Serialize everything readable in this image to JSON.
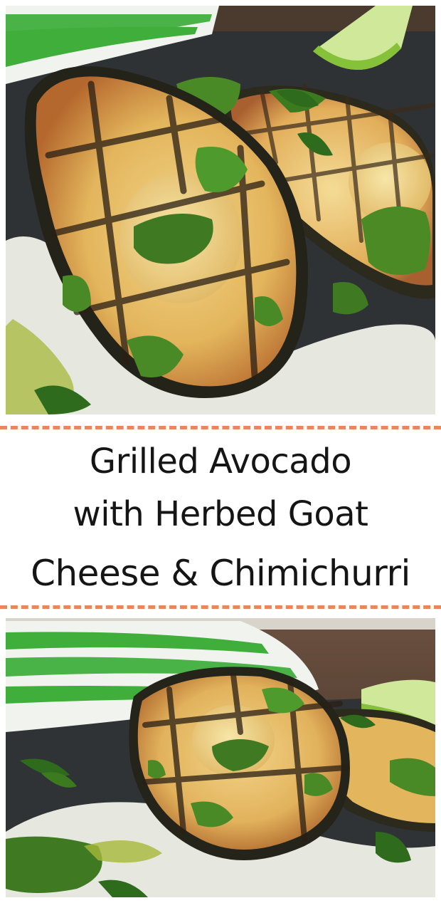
{
  "pin": {
    "title": {
      "line1": "Grilled Avocado",
      "line2_light": "with",
      "line2_strong": "Herbed Goat",
      "line3_strong_a": "Cheese",
      "line3_amp": "&",
      "line3_strong_b": "Chimichurri"
    },
    "colors": {
      "divider": "#e8875f",
      "title_text": "#151515",
      "slate": "#2f3336",
      "avocado_flesh": "#e2b860",
      "avocado_skin": "#2b2a1c",
      "chimichurri": "#3f7a22",
      "goat_cheese": "#e8eae2",
      "towel_stripe": "#3fae3a",
      "lime": "#8cc63e",
      "wood": "#5b4636"
    }
  }
}
